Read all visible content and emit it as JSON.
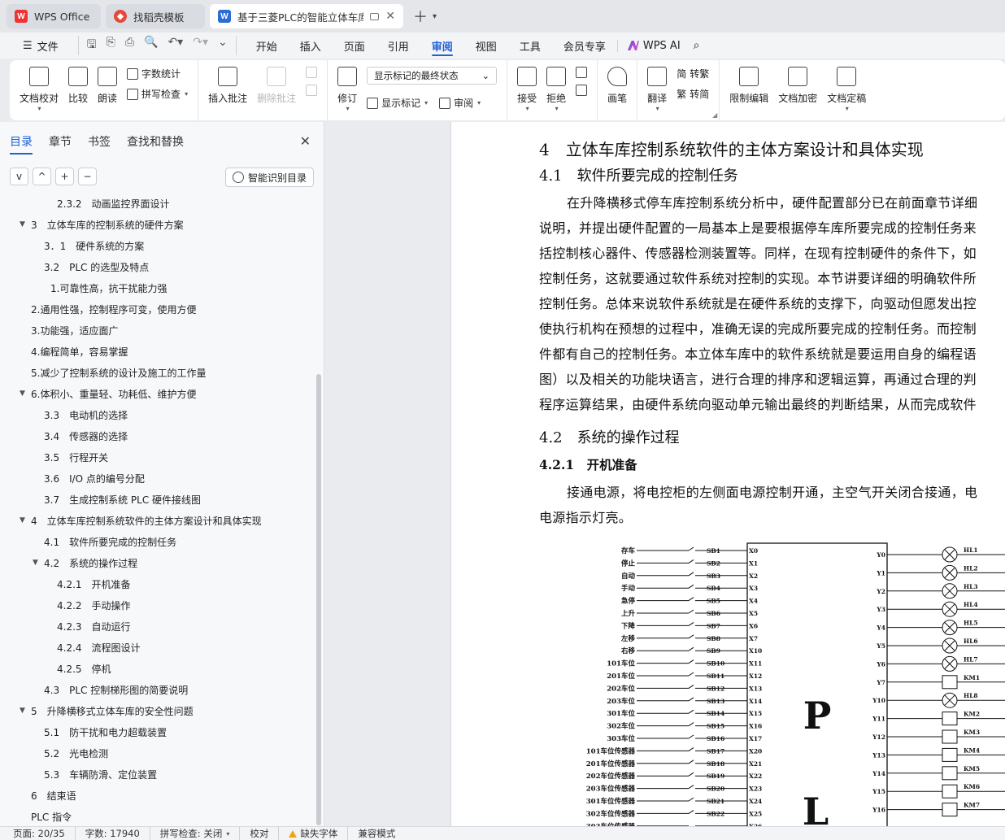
{
  "tabs": [
    {
      "label": "WPS Office",
      "icon": "wps-logo-icon"
    },
    {
      "label": "找稻壳模板",
      "icon": "daoke-logo-icon"
    },
    {
      "label": "基于三菱PLC的智能立体车库控",
      "icon": "writer-doc-icon"
    }
  ],
  "menu": {
    "file": "文件",
    "items": [
      "开始",
      "插入",
      "页面",
      "引用",
      "审阅",
      "视图",
      "工具",
      "会员专享"
    ],
    "active": "审阅",
    "ai_label": "WPS AI"
  },
  "ribbon": {
    "doc_check": "文档校对",
    "compare": "比较",
    "read_aloud": "朗读",
    "word_count": "字数统计",
    "spell_check": "拼写检查",
    "insert_comment": "插入批注",
    "delete_comment": "删除批注",
    "revise": "修订",
    "markup_select": "显示标记的最终状态",
    "show_markup": "显示标记",
    "review_pane": "审阅",
    "accept": "接受",
    "reject": "拒绝",
    "pen": "画笔",
    "translate": "翻译",
    "to_traditional": "转繁",
    "to_simplified": "转简",
    "restrict_edit": "限制编辑",
    "encrypt": "文档加密",
    "finalize": "文档定稿"
  },
  "panel": {
    "tabs": [
      "目录",
      "章节",
      "书签",
      "查找和替换"
    ],
    "active_tab": "目录",
    "tools": [
      "v",
      "^",
      "+",
      "−"
    ],
    "smart_button": "智能识别目录",
    "toc": [
      {
        "text": "2.3.2　动画监控界面设计",
        "level": 3,
        "arrow": ""
      },
      {
        "text": "3　立体车库的控制系统的硬件方案",
        "level": 1,
        "arrow": "▼"
      },
      {
        "text": "3．1　硬件系统的方案",
        "level": 2,
        "arrow": ""
      },
      {
        "text": "3.2　PLC 的选型及特点",
        "level": 2,
        "arrow": ""
      },
      {
        "text": "1.可靠性高，抗干扰能力强",
        "level": 2.5,
        "arrow": ""
      },
      {
        "text": "2.通用性强，控制程序可变，使用方便",
        "level": 0,
        "arrow": ""
      },
      {
        "text": "3.功能强，适应面广",
        "level": 0,
        "arrow": ""
      },
      {
        "text": "4.编程简单，容易掌握",
        "level": 0,
        "arrow": ""
      },
      {
        "text": "5.减少了控制系统的设计及施工的工作量",
        "level": 0,
        "arrow": ""
      },
      {
        "text": "6.体积小、重量轻、功耗低、维护方便",
        "level": 0,
        "arrow": "▼"
      },
      {
        "text": "3.3　电动机的选择",
        "level": 2,
        "arrow": ""
      },
      {
        "text": "3.4　传感器的选择",
        "level": 2,
        "arrow": ""
      },
      {
        "text": "3.5　行程开关",
        "level": 2,
        "arrow": ""
      },
      {
        "text": "3.6　I/O 点的编号分配",
        "level": 2,
        "arrow": ""
      },
      {
        "text": "3.7　生成控制系统 PLC 硬件接线图",
        "level": 2,
        "arrow": ""
      },
      {
        "text": "4　立体车库控制系统软件的主体方案设计和具体实现",
        "level": 1,
        "arrow": "▼"
      },
      {
        "text": "4.1　软件所要完成的控制任务",
        "level": 2,
        "arrow": ""
      },
      {
        "text": "4.2　系统的操作过程",
        "level": 2,
        "arrow": "▼"
      },
      {
        "text": "4.2.1　开机准备",
        "level": 3,
        "arrow": ""
      },
      {
        "text": "4.2.2　手动操作",
        "level": 3,
        "arrow": ""
      },
      {
        "text": "4.2.3　自动运行",
        "level": 3,
        "arrow": ""
      },
      {
        "text": "4.2.4　流程图设计",
        "level": 3,
        "arrow": ""
      },
      {
        "text": "4.2.5　停机",
        "level": 3,
        "arrow": ""
      },
      {
        "text": "4.3　PLC 控制梯形图的简要说明",
        "level": 2,
        "arrow": ""
      },
      {
        "text": "5　升降横移式立体车库的安全性问题",
        "level": 1,
        "arrow": "▼"
      },
      {
        "text": "5.1　防干扰和电力超载装置",
        "level": 2,
        "arrow": ""
      },
      {
        "text": "5.2　光电检测",
        "level": 2,
        "arrow": ""
      },
      {
        "text": "5.3　车辆防滑、定位装置",
        "level": 2,
        "arrow": ""
      },
      {
        "text": "6　结束语",
        "level": 1,
        "arrow": ""
      },
      {
        "text": "PLC 指令",
        "level": 0,
        "arrow": ""
      }
    ]
  },
  "document": {
    "h1": "4　立体车库控制系统软件的主体方案设计和具体实现",
    "h2a": "4.1　软件所要完成的控制任务",
    "para1": [
      "在升降横移式停车库控制系统分析中，硬件配置部分已在前面章节详细",
      "说明，并提出硬件配置的一局基本上是要根据停车库所要完成的控制任务来",
      "括控制核心器件、传感器检测装置等。同样，在现有控制硬件的条件下，如",
      "控制任务，这就要通过软件系统对控制的实现。本节讲要详细的明确软件所",
      "控制任务。总体来说软件系统就是在硬件系统的支撑下，向驱动但愿发出控",
      "使执行机构在预想的过程中，准确无误的完成所要完成的控制任务。而控制",
      "件都有自己的控制任务。本立体车库中的软件系统就是要运用自身的编程语",
      "图）以及相关的功能块语言，进行合理的排序和逻辑运算，再通过合理的判",
      "程序运算结果，由硬件系统向驱动单元输出最终的判断结果，从而完成软件"
    ],
    "h2b": "4.2　系统的操作过程",
    "h3": "4.2.1　开机准备",
    "para2": [
      "接通电源，将电控柜的左侧面电源控制开通，主空气开关闭合接通，电",
      "电源指示灯亮。"
    ],
    "diagram": {
      "plc_letters": [
        "P",
        "L"
      ],
      "input_labels": [
        "存车",
        "停止",
        "自动",
        "手动",
        "急停",
        "上升",
        "下降",
        "左移",
        "右移",
        "101车位",
        "201车位",
        "202车位",
        "203车位",
        "301车位",
        "302车位",
        "303车位",
        "101车位传感器",
        "201车位传感器",
        "202车位传感器",
        "203车位传感器",
        "301车位传感器",
        "302车位传感器",
        "303车位传感器"
      ],
      "switches": [
        "SB1",
        "SB2",
        "SB3",
        "SB4",
        "SB5",
        "SB6",
        "SB7",
        "SB8",
        "SB9",
        "SB10",
        "SB11",
        "SB12",
        "SB13",
        "SB14",
        "SB15",
        "SB16",
        "SB17",
        "SB18",
        "SB19",
        "SB20",
        "SB21",
        "SB22"
      ],
      "x_terminals": [
        "X0",
        "X1",
        "X2",
        "X3",
        "X4",
        "X5",
        "X6",
        "X7",
        "X10",
        "X11",
        "X12",
        "X13",
        "X14",
        "X15",
        "X16",
        "X17",
        "X20",
        "X21",
        "X22",
        "X23",
        "X24",
        "X25",
        "X26"
      ],
      "y_terminals": [
        "Y0",
        "Y1",
        "Y2",
        "Y3",
        "Y4",
        "Y5",
        "Y6",
        "Y7",
        "Y10",
        "Y11",
        "Y12",
        "Y13",
        "Y14",
        "Y15",
        "Y16"
      ],
      "outputs": [
        {
          "label": "HL1",
          "kind": "lamp"
        },
        {
          "label": "HL2",
          "kind": "lamp"
        },
        {
          "label": "HL3",
          "kind": "lamp"
        },
        {
          "label": "HL4",
          "kind": "lamp"
        },
        {
          "label": "HL5",
          "kind": "lamp"
        },
        {
          "label": "HL6",
          "kind": "lamp"
        },
        {
          "label": "HL7",
          "kind": "lamp"
        },
        {
          "label": "KM1",
          "kind": "coil"
        },
        {
          "label": "HL8",
          "kind": "lamp"
        },
        {
          "label": "KM2",
          "kind": "coil"
        },
        {
          "label": "KM3",
          "kind": "coil"
        },
        {
          "label": "KM4",
          "kind": "coil"
        },
        {
          "label": "KM5",
          "kind": "coil"
        },
        {
          "label": "KM6",
          "kind": "coil"
        },
        {
          "label": "KM7",
          "kind": "coil"
        }
      ]
    }
  },
  "status": {
    "page": "页面: 20/35",
    "words": "字数: 17940",
    "spell": "拼写检查: 关闭",
    "proof": "校对",
    "missing_font": "缺失字体",
    "compat": "兼容模式"
  }
}
